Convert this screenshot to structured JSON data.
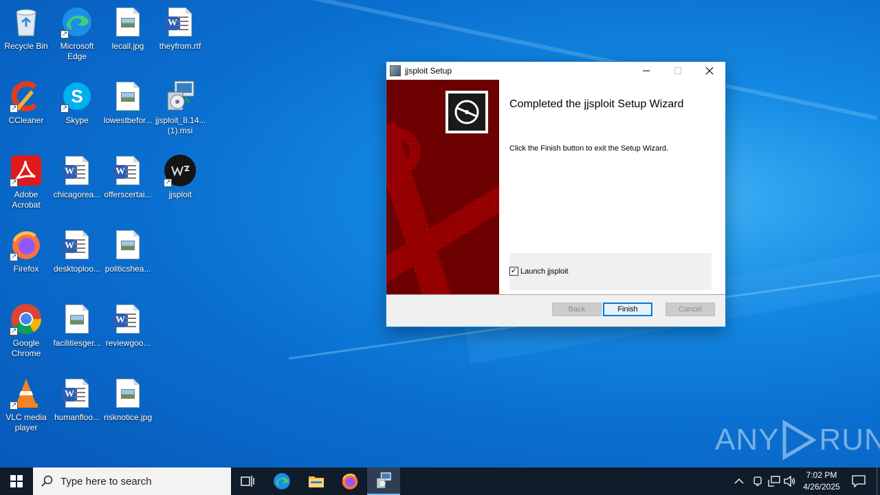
{
  "desktop": {
    "icons": [
      {
        "label": "Recycle Bin",
        "icon": "recycle-bin-icon"
      },
      {
        "label": "Microsoft Edge",
        "icon": "edge-icon"
      },
      {
        "label": "lecall.jpg",
        "icon": "image-file-icon"
      },
      {
        "label": "theyfrom.rtf",
        "icon": "word-document-icon"
      },
      {
        "label": "CCleaner",
        "icon": "ccleaner-icon"
      },
      {
        "label": "Skype",
        "icon": "skype-icon"
      },
      {
        "label": "lowestbefor...",
        "icon": "image-file-icon"
      },
      {
        "label": "jjsploit_8.14...(1).msi",
        "icon": "msi-installer-icon"
      },
      {
        "label": "Adobe Acrobat",
        "icon": "acrobat-icon"
      },
      {
        "label": "chicagorea...",
        "icon": "word-document-icon"
      },
      {
        "label": "offerscertai...",
        "icon": "word-document-icon"
      },
      {
        "label": "jjsploit",
        "icon": "jjsploit-icon"
      },
      {
        "label": "Firefox",
        "icon": "firefox-icon"
      },
      {
        "label": "desktoploo...",
        "icon": "word-document-icon"
      },
      {
        "label": "politicshea...",
        "icon": "image-file-icon"
      },
      {
        "label": "Google Chrome",
        "icon": "chrome-icon"
      },
      {
        "label": "facilitiesger...",
        "icon": "image-file-icon"
      },
      {
        "label": "reviewgoo...",
        "icon": "word-document-icon"
      },
      {
        "label": "VLC media player",
        "icon": "vlc-icon"
      },
      {
        "label": "humanfloo...",
        "icon": "word-document-icon"
      },
      {
        "label": "risknotice.jpg",
        "icon": "image-file-icon"
      }
    ]
  },
  "window": {
    "title": "jjsploit Setup",
    "heading": "Completed the jjsploit Setup Wizard",
    "message": "Click the Finish button to exit the Setup Wizard.",
    "launch_label": "Launch jjsploit",
    "launch_checked": true,
    "buttons": {
      "back": "Back",
      "finish": "Finish",
      "cancel": "Cancel"
    }
  },
  "watermark": {
    "left": "ANY",
    "right": "RUN"
  },
  "taskbar": {
    "search_placeholder": "Type here to search",
    "time": "7:02 PM",
    "date": "4/26/2025"
  },
  "colors": {
    "accent": "#0078d7",
    "banner_red": "#8a0000",
    "taskbar": "#101c2a"
  }
}
